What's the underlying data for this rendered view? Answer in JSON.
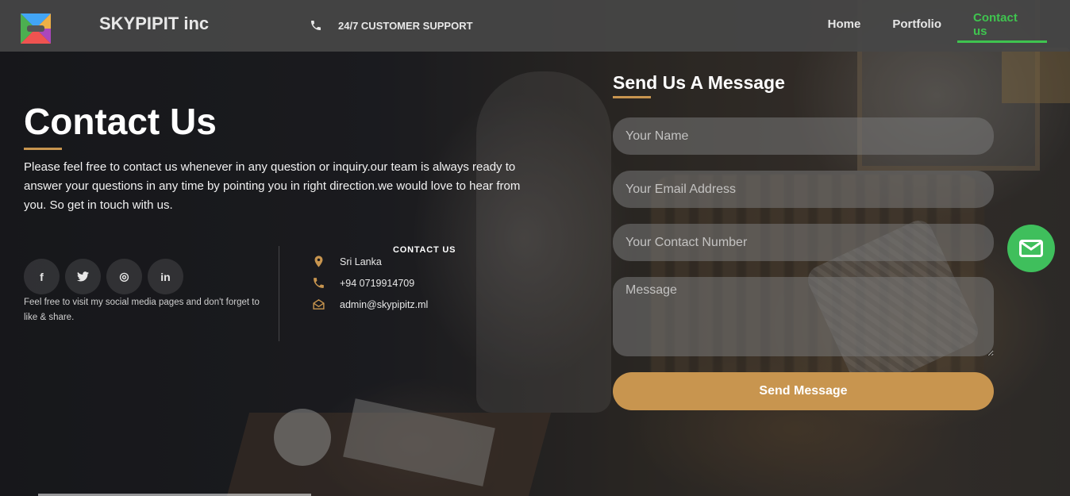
{
  "header": {
    "brand": "SKYPIPIT inc",
    "support_label": "24/7 CUSTOMER SUPPORT",
    "nav": [
      {
        "label": "Home",
        "active": false
      },
      {
        "label": "Portfolio",
        "active": false
      },
      {
        "label": "Contact us",
        "active": true
      }
    ]
  },
  "hero": {
    "title": "Contact Us",
    "intro": "Please feel free to contact us whenever in any question or inquiry.our team is always ready to answer your questions in any time by pointing you in right direction.we would love to hear from you. So get in touch with us."
  },
  "social": {
    "icons": [
      "facebook-icon",
      "twitter-icon",
      "instagram-icon",
      "linkedin-icon"
    ],
    "glyphs": [
      "f",
      "t",
      "◎",
      "in"
    ],
    "note": "Feel free to visit my social media pages and don't forget to like & share."
  },
  "contact": {
    "heading": "CONTACT US",
    "location": "Sri Lanka",
    "phone": "+94 0719914709",
    "email": "admin@skypipitz.ml"
  },
  "form": {
    "title": "Send Us A Message",
    "name_placeholder": "Your Name",
    "email_placeholder": "Your Email Address",
    "number_placeholder": "Your Contact Number",
    "message_placeholder": "Message",
    "submit_label": "Send Message"
  },
  "colors": {
    "accent": "#c8954f",
    "active_nav": "#3fc44f",
    "fab": "#3fbf5c",
    "header_bg": "#464646"
  }
}
